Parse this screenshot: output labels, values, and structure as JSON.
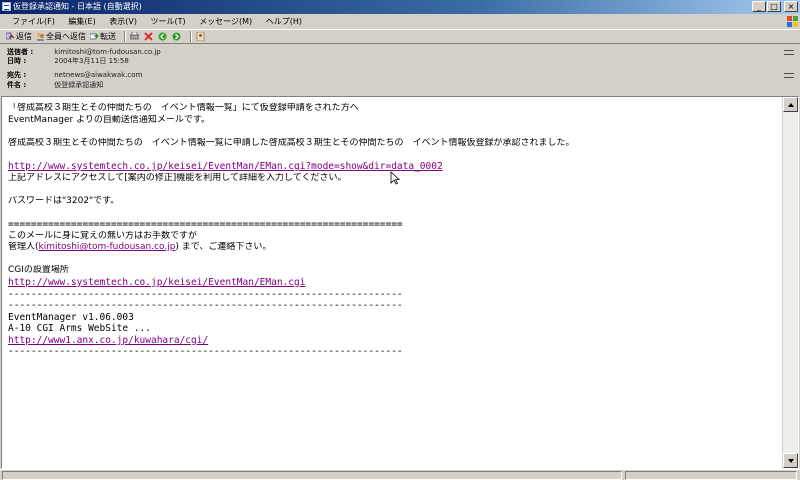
{
  "window": {
    "title": "仮登録承認通知 - 日本語 (自動選択)",
    "controls": [
      "0",
      "1",
      "r"
    ]
  },
  "menu": [
    "ファイル(F)",
    "編集(E)",
    "表示(V)",
    "ツール(T)",
    "メッセージ(M)",
    "ヘルプ(H)"
  ],
  "toolbar": {
    "reply": "返信",
    "reply_all": "全員へ返信",
    "forward": "転送"
  },
  "header": {
    "from_label": "送信者 :",
    "from_value": "kimitoshi@tom-fudousan.co.jp",
    "date_label": "日時 :",
    "date_value": "2004年3月11日 15:58",
    "to_label": "宛先 :",
    "to_value": "netnews@aiwakwak.com",
    "subject_label": "件名 :",
    "subject_value": "仮登録承認通知"
  },
  "body": {
    "l1": "「啓成高校３期生とその仲間たちの　イベント情報一覧」にて仮登録申請をされた方へ",
    "l2": "EventManager よりの自動送信通知メールです。",
    "l3": "啓成高校３期生とその仲間たちの　イベント情報一覧に申請した啓成高校３期生とその仲間たちの　イベント情報仮登録が承認されました。",
    "l4_link": "http://www.systemtech.co.jp/keisei/EventMan/EMan.cgi?mode=show&dir=data_0002",
    "l5": "上記アドレスにアクセスして[案内の修正]機能を利用して詳細を入力してください。",
    "l6": "パスワードは\"3202\"です。",
    "l7": "=====================================================================",
    "l8": "このメールに身に覚えの無い方はお手数ですが",
    "l9_pre": "管理人(",
    "l9_link": "kimitoshi@tom-fudousan.co.jp",
    "l9_post": ") まで、ご連絡下さい。",
    "l10": "CGIの設置場所",
    "l11_link": "http://www.systemtech.co.jp/keisei/EventMan/EMan.cgi",
    "l12": "---------------------------------------------------------------------",
    "l13": "---------------------------------------------------------------------",
    "l14": "EventManager v1.06.003",
    "l15": "A-10 CGI Arms WebSite ...",
    "l16_link": "http://www1.anx.co.jp/kuwahara/cgi/",
    "l17": "---------------------------------------------------------------------"
  }
}
